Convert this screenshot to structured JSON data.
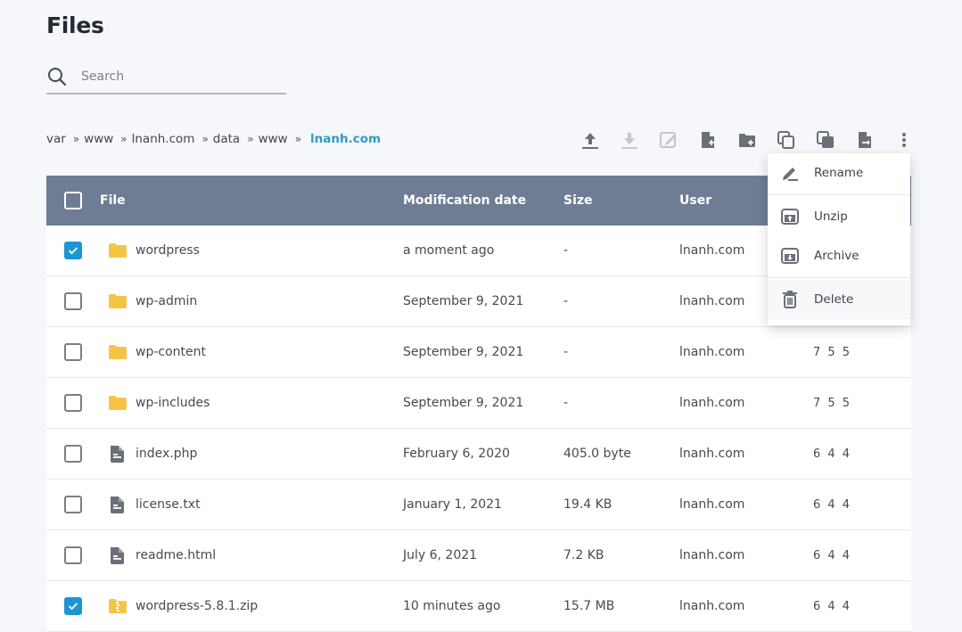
{
  "page": {
    "title": "Files"
  },
  "search": {
    "placeholder": "Search",
    "value": ""
  },
  "breadcrumb": [
    {
      "label": "var",
      "active": false
    },
    {
      "label": "www",
      "active": false
    },
    {
      "label": "lnanh.com",
      "active": false
    },
    {
      "label": "data",
      "active": false
    },
    {
      "label": "www",
      "active": false
    },
    {
      "label": "lnanh.com",
      "active": true
    }
  ],
  "breadcrumb_separator": "»",
  "toolbar": [
    {
      "icon": "upload-icon",
      "label": "Upload",
      "enabled": true
    },
    {
      "icon": "download-icon",
      "label": "Download",
      "enabled": false
    },
    {
      "icon": "edit-icon",
      "label": "Edit",
      "enabled": false
    },
    {
      "icon": "new-file-icon",
      "label": "New file",
      "enabled": true
    },
    {
      "icon": "new-folder-icon",
      "label": "New folder",
      "enabled": true
    },
    {
      "icon": "copy-icon",
      "label": "Copy",
      "enabled": true
    },
    {
      "icon": "duplicate-icon",
      "label": "Duplicate",
      "enabled": true
    },
    {
      "icon": "move-icon",
      "label": "Move",
      "enabled": true
    },
    {
      "icon": "more-vertical-icon",
      "label": "More",
      "enabled": true
    }
  ],
  "table": {
    "columns": {
      "file": "File",
      "date": "Modification date",
      "size": "Size",
      "user": "User"
    },
    "rows": [
      {
        "name": "wordpress",
        "type": "folder",
        "date": "a moment ago",
        "size": "-",
        "user": "lnanh.com",
        "perm": "",
        "checked": true
      },
      {
        "name": "wp-admin",
        "type": "folder",
        "date": "September 9, 2021",
        "size": "-",
        "user": "lnanh.com",
        "perm": "",
        "checked": false
      },
      {
        "name": "wp-content",
        "type": "folder",
        "date": "September 9, 2021",
        "size": "-",
        "user": "lnanh.com",
        "perm": "7 5 5",
        "checked": false
      },
      {
        "name": "wp-includes",
        "type": "folder",
        "date": "September 9, 2021",
        "size": "-",
        "user": "lnanh.com",
        "perm": "7 5 5",
        "checked": false
      },
      {
        "name": "index.php",
        "type": "file",
        "date": "February 6, 2020",
        "size": "405.0 byte",
        "user": "lnanh.com",
        "perm": "6 4 4",
        "checked": false
      },
      {
        "name": "license.txt",
        "type": "file",
        "date": "January 1, 2021",
        "size": "19.4 KB",
        "user": "lnanh.com",
        "perm": "6 4 4",
        "checked": false
      },
      {
        "name": "readme.html",
        "type": "file",
        "date": "July 6, 2021",
        "size": "7.2 KB",
        "user": "lnanh.com",
        "perm": "6 4 4",
        "checked": false
      },
      {
        "name": "wordpress-5.8.1.zip",
        "type": "zip",
        "date": "10 minutes ago",
        "size": "15.7 MB",
        "user": "lnanh.com",
        "perm": "6 4 4",
        "checked": true
      }
    ]
  },
  "context_menu": {
    "items": [
      {
        "icon": "rename-icon",
        "label": "Rename"
      },
      {
        "icon": "unzip-icon",
        "label": "Unzip"
      },
      {
        "icon": "archive-icon",
        "label": "Archive"
      },
      {
        "icon": "delete-icon",
        "label": "Delete"
      }
    ]
  },
  "colors": {
    "accent": "#2d9bc6",
    "checkbox_checked": "#1c96d3",
    "header_bg": "#6e7d94",
    "folder": "#f6c445",
    "icon_gray": "#6b6f78"
  }
}
